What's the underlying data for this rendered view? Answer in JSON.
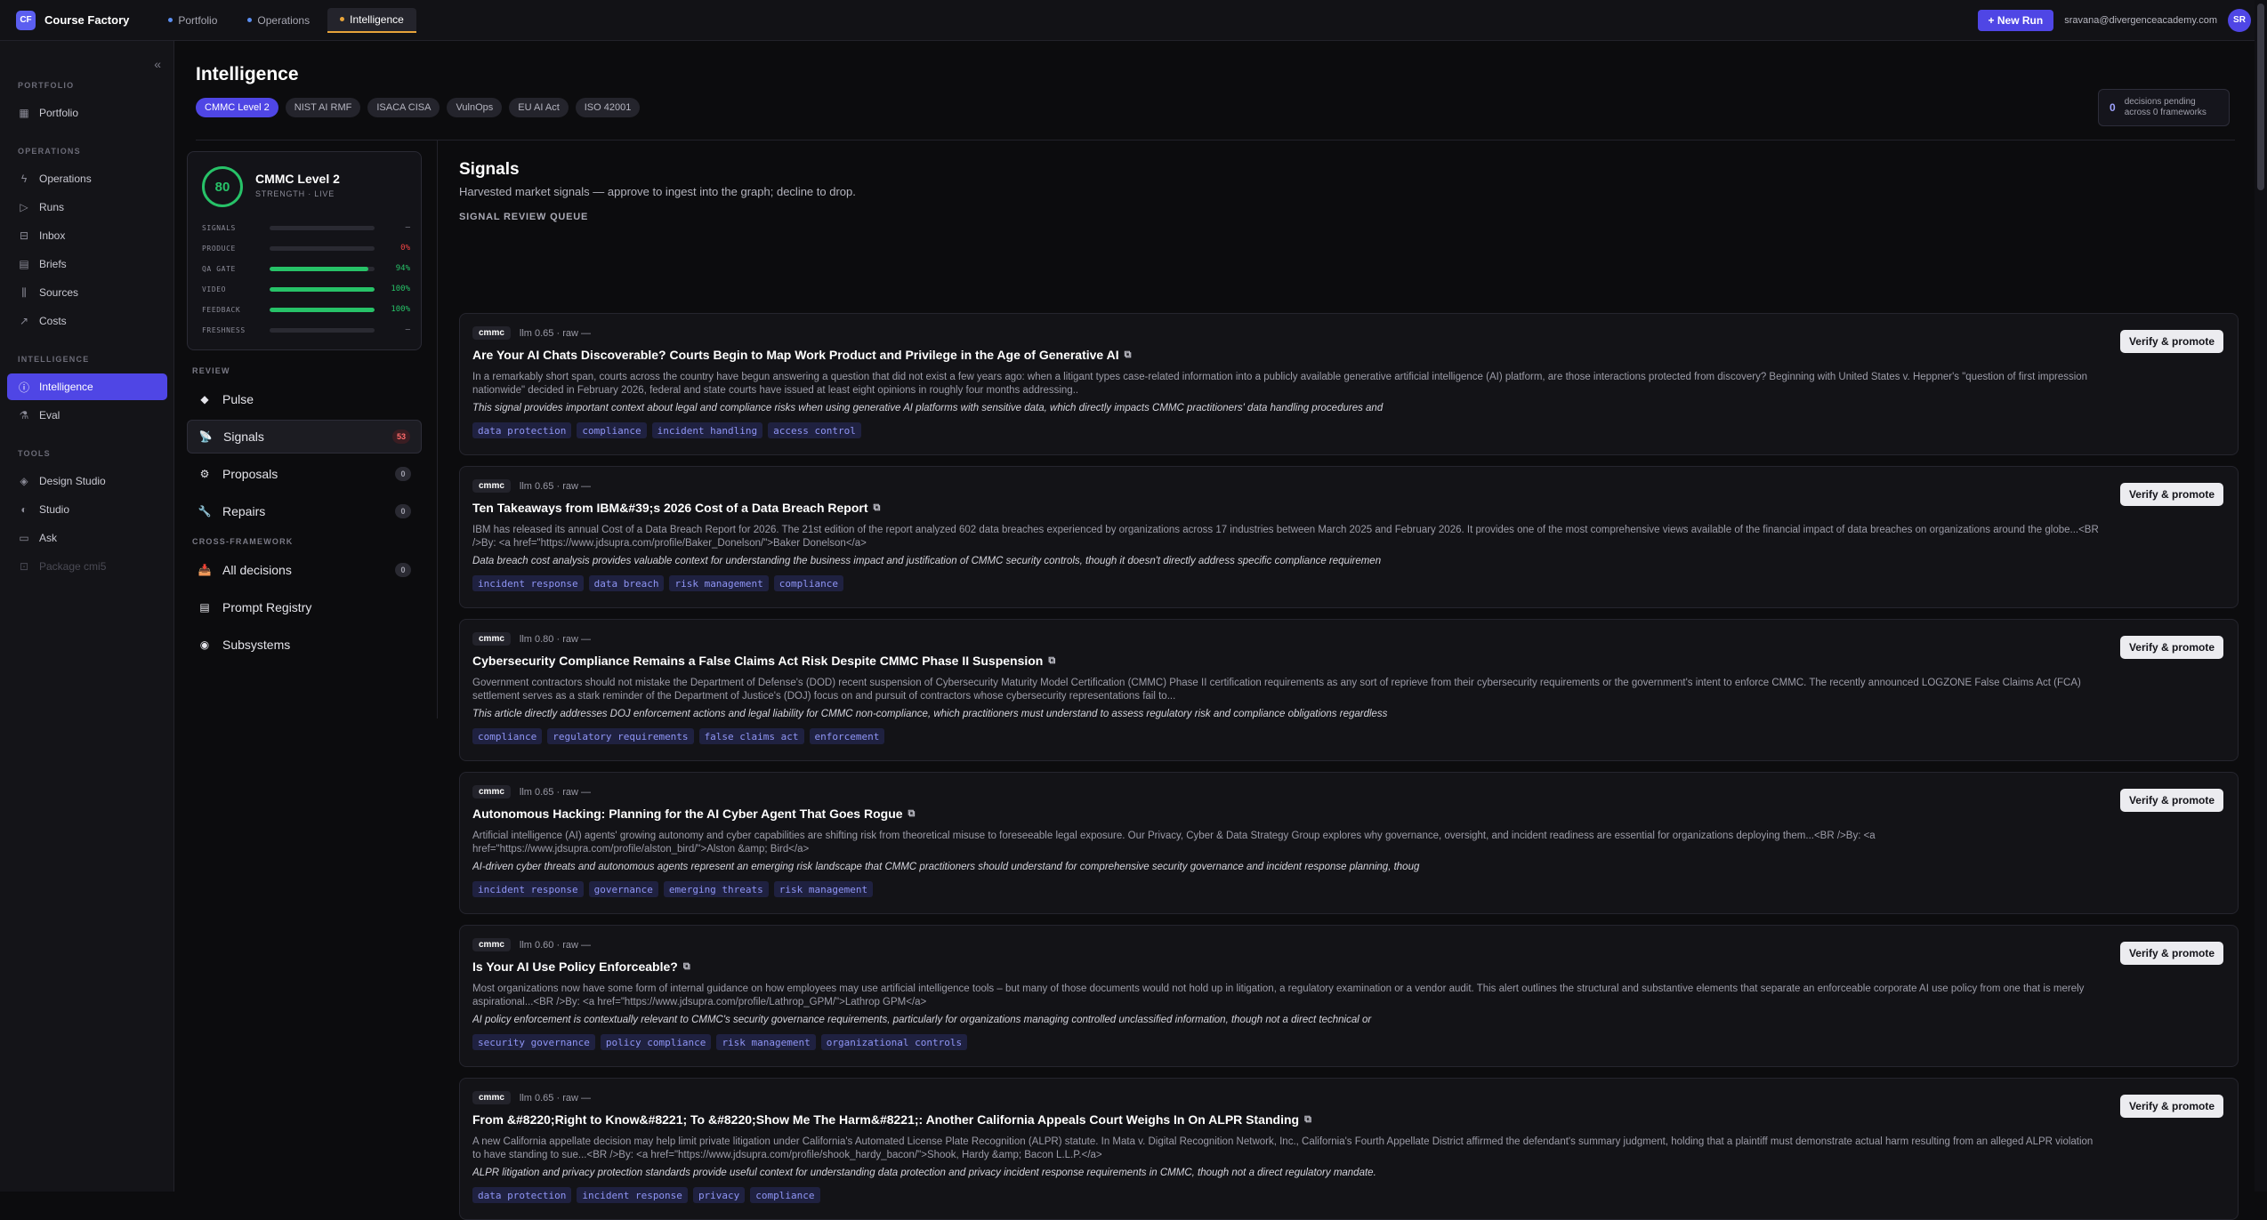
{
  "app": {
    "logo": "CF",
    "name": "Course Factory"
  },
  "topnav": [
    {
      "label": "Portfolio"
    },
    {
      "label": "Operations"
    },
    {
      "label": "Intelligence"
    }
  ],
  "top_right": {
    "new_run": "+ New Run",
    "email": "sravana@divergenceacademy.com",
    "avatar": "SR"
  },
  "sidebar": {
    "collapse": "«",
    "portfolio_title": "PORTFOLIO",
    "operations_title": "OPERATIONS",
    "intelligence_title": "INTELLIGENCE",
    "tools_title": "TOOLS",
    "items": {
      "portfolio": "Portfolio",
      "operations": "Operations",
      "runs": "Runs",
      "inbox": "Inbox",
      "briefs": "Briefs",
      "sources": "Sources",
      "costs": "Costs",
      "intelligence": "Intelligence",
      "eval": "Eval",
      "design_studio": "Design Studio",
      "studio": "Studio",
      "ask": "Ask",
      "package": "Package cmi5"
    }
  },
  "header": {
    "title": "Intelligence",
    "frameworks": [
      "CMMC Level 2",
      "NIST AI RMF",
      "ISACA CISA",
      "VulnOps",
      "EU AI Act",
      "ISO 42001"
    ],
    "pending_count": "0",
    "pending_line1": "decisions pending",
    "pending_line2": "across 0 frameworks"
  },
  "strength": {
    "score": "80",
    "name": "CMMC Level 2",
    "sub": "STRENGTH · LIVE",
    "metrics": [
      {
        "label": "SIGNALS",
        "value": "—",
        "pct": 0
      },
      {
        "label": "PRODUCE",
        "value": "0%",
        "pct": 0
      },
      {
        "label": "QA GATE",
        "value": "94%",
        "pct": 94
      },
      {
        "label": "VIDEO",
        "value": "100%",
        "pct": 100
      },
      {
        "label": "FEEDBACK",
        "value": "100%",
        "pct": 100
      },
      {
        "label": "FRESHNESS",
        "value": "—",
        "pct": 0
      }
    ]
  },
  "review": {
    "title": "REVIEW",
    "items": [
      {
        "label": "Pulse",
        "badge": ""
      },
      {
        "label": "Signals",
        "badge": "53"
      },
      {
        "label": "Proposals",
        "badge": "0"
      },
      {
        "label": "Repairs",
        "badge": "0"
      }
    ]
  },
  "cross": {
    "title": "CROSS-FRAMEWORK",
    "items": [
      {
        "label": "All decisions",
        "badge": "0"
      },
      {
        "label": "Prompt Registry",
        "badge": ""
      },
      {
        "label": "Subsystems",
        "badge": ""
      }
    ]
  },
  "signals": {
    "title": "Signals",
    "subtitle": "Harvested market signals — approve to ingest into the graph; decline to drop.",
    "queue_title": "SIGNAL REVIEW QUEUE",
    "verify_label": "Verify & promote",
    "cards": [
      {
        "source": "cmmc",
        "meta": "llm 0.65 · raw —",
        "title": "Are Your AI Chats Discoverable? Courts Begin to Map Work Product and Privilege in the Age of Generative AI",
        "desc": "In a remarkably short span, courts across the country have begun answering a question that did not exist a few years ago: when a litigant types case-related information into a publicly available generative artificial intelligence (AI) platform, are those interactions protected from discovery? Beginning with United States v. Heppner's \"question of first impression nationwide\" decided in February 2026, federal and state courts have issued at least eight opinions in roughly four months addressing..",
        "note": "This signal provides important context about legal and compliance risks when using generative AI platforms with sensitive data, which directly impacts CMMC practitioners' data handling procedures and",
        "tags": [
          "data protection",
          "compliance",
          "incident handling",
          "access control"
        ]
      },
      {
        "source": "cmmc",
        "meta": "llm 0.65 · raw —",
        "title": "Ten Takeaways from IBM&#39;s 2026 Cost of a Data Breach Report",
        "desc": "IBM has released its annual Cost of a Data Breach Report for 2026. The 21st edition of the report analyzed 602 data breaches experienced by organizations across 17 industries between March 2025 and February 2026. It provides one of the most comprehensive views available of the financial impact of data breaches on organizations around the globe...<BR />By: <a href=\"https://www.jdsupra.com/profile/Baker_Donelson/\">Baker Donelson</a>",
        "note": "Data breach cost analysis provides valuable context for understanding the business impact and justification of CMMC security controls, though it doesn't directly address specific compliance requiremen",
        "tags": [
          "incident response",
          "data breach",
          "risk management",
          "compliance"
        ]
      },
      {
        "source": "cmmc",
        "meta": "llm 0.80 · raw —",
        "title": "Cybersecurity Compliance Remains a False Claims Act Risk Despite CMMC Phase II Suspension",
        "desc": "Government contractors should not mistake the Department of Defense's (DOD) recent suspension of Cybersecurity Maturity Model Certification (CMMC) Phase II certification requirements as any sort of reprieve from their cybersecurity requirements or the government's intent to enforce CMMC. The recently announced LOGZONE False Claims Act (FCA) settlement serves as a stark reminder of the Department of Justice's (DOJ) focus on and pursuit of contractors whose cybersecurity representations fail to...",
        "note": "This article directly addresses DOJ enforcement actions and legal liability for CMMC non-compliance, which practitioners must understand to assess regulatory risk and compliance obligations regardless",
        "tags": [
          "compliance",
          "regulatory requirements",
          "false claims act",
          "enforcement"
        ]
      },
      {
        "source": "cmmc",
        "meta": "llm 0.65 · raw —",
        "title": "Autonomous Hacking: Planning for the AI Cyber Agent That Goes Rogue",
        "desc": "Artificial intelligence (AI) agents' growing autonomy and cyber capabilities are shifting risk from theoretical misuse to foreseeable legal exposure. Our Privacy, Cyber & Data Strategy Group explores why governance, oversight, and incident readiness are essential for organizations deploying them...<BR />By: <a href=\"https://www.jdsupra.com/profile/alston_bird/\">Alston &amp; Bird</a>",
        "note": "AI-driven cyber threats and autonomous agents represent an emerging risk landscape that CMMC practitioners should understand for comprehensive security governance and incident response planning, thoug",
        "tags": [
          "incident response",
          "governance",
          "emerging threats",
          "risk management"
        ]
      },
      {
        "source": "cmmc",
        "meta": "llm 0.60 · raw —",
        "title": "Is Your AI Use Policy Enforceable?",
        "desc": "Most organizations now have some form of internal guidance on how employees may use artificial intelligence tools – but many of those documents would not hold up in litigation, a regulatory examination or a vendor audit. This alert outlines the structural and substantive elements that separate an enforceable corporate AI use policy from one that is merely aspirational...<BR />By: <a href=\"https://www.jdsupra.com/profile/Lathrop_GPM/\">Lathrop GPM</a>",
        "note": "AI policy enforcement is contextually relevant to CMMC's security governance requirements, particularly for organizations managing controlled unclassified information, though not a direct technical or",
        "tags": [
          "security governance",
          "policy compliance",
          "risk management",
          "organizational controls"
        ]
      },
      {
        "source": "cmmc",
        "meta": "llm 0.65 · raw —",
        "title": "From &#8220;Right to Know&#8221; To &#8220;Show Me The Harm&#8221;: Another California Appeals Court Weighs In On ALPR Standing",
        "desc": "A new California appellate decision may help limit private litigation under California's Automated License Plate Recognition (ALPR) statute. In Mata v. Digital Recognition Network, Inc., California's Fourth Appellate District affirmed the defendant's summary judgment, holding that a plaintiff must demonstrate actual harm resulting from an alleged ALPR violation to have standing to sue...<BR />By: <a href=\"https://www.jdsupra.com/profile/shook_hardy_bacon/\">Shook, Hardy &amp; Bacon L.L.P.</a>",
        "note": "ALPR litigation and privacy protection standards provide useful context for understanding data protection and privacy incident response requirements in CMMC, though not a direct regulatory mandate.",
        "tags": [
          "data protection",
          "incident response",
          "privacy",
          "compliance"
        ]
      }
    ]
  }
}
